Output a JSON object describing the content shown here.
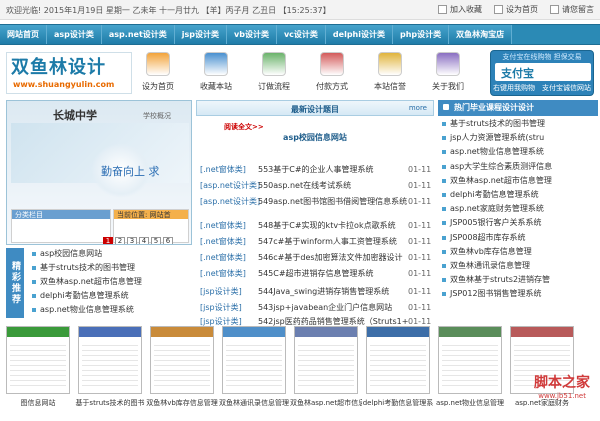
{
  "topbar": {
    "welcome": "欢迎光临! 2015年1月19日 星期一 乙未年 十一月廿九 【羊】丙子月 乙丑日 【15:25:37】",
    "links": [
      "加入收藏",
      "设为首页",
      "请您留言"
    ]
  },
  "nav": [
    "网站首页",
    "asp设计类",
    "asp.net设计类",
    "jsp设计类",
    "vb设计类",
    "vc设计类",
    "delphi设计类",
    "php设计类",
    "双鱼林淘宝店"
  ],
  "logo": {
    "text": "双鱼林设计",
    "url": "www.shuangyulin.com"
  },
  "quick": [
    {
      "label": "设为首页",
      "icon": "house-icon",
      "color": "#f2a33a"
    },
    {
      "label": "收藏本站",
      "icon": "bookmark-icon",
      "color": "#4a90d0"
    },
    {
      "label": "订做流程",
      "icon": "clipboard-icon",
      "color": "#6bb36b"
    },
    {
      "label": "付款方式",
      "icon": "payment-icon",
      "color": "#d35b5b"
    },
    {
      "label": "本站信誉",
      "icon": "medal-icon",
      "color": "#e0b43c"
    },
    {
      "label": "关于我们",
      "icon": "people-icon",
      "color": "#8a6fc2"
    }
  ],
  "alipay": {
    "top": "支付宝在线购物 担保交易",
    "logo": "支付宝",
    "left": "右键用我购物",
    "right": "支付宝诚信网站"
  },
  "banner": {
    "title": "长城中学",
    "sub": "学校概况",
    "motto": "勤奋向上  求",
    "box1": "分类栏目",
    "box2": "当前位置:  网站首"
  },
  "pager": [
    "1",
    "2",
    "3",
    "4",
    "5",
    "6"
  ],
  "recommend": {
    "tag": "精彩推荐",
    "items": [
      "asp校园信息网站",
      "基于struts技术的图书管理",
      "双鱼林asp.net超市信息管理",
      "delphi考勤信息管理系统",
      "asp.net物业信息管理系统"
    ]
  },
  "latest": {
    "title": "最新设计题目",
    "more": "more",
    "detail": "阅读全文>>",
    "featured": "asp校园信息网站",
    "rows": [
      {
        "cat": "[.net窗体类]",
        "title": "553基于C#的企业人事管理系统",
        "date": "01-11"
      },
      {
        "cat": "[asp.net设计类]",
        "title": "550asp.net在线考试系统",
        "date": "01-11"
      },
      {
        "cat": "[asp.net设计类]",
        "title": "549asp.net图书馆图书借阅管理信息系统",
        "date": "01-11"
      },
      {
        "cat": "[.net窗体类]",
        "title": "548基于C#实现的ktv卡拉ok点歌系统",
        "date": "01-11"
      },
      {
        "cat": "[.net窗体类]",
        "title": "547c#基于winform人事工资管理系统",
        "date": "01-11"
      },
      {
        "cat": "[.net窗体类]",
        "title": "546c#基于des加密算法文件加密器设计",
        "date": "01-11"
      },
      {
        "cat": "[.net窗体类]",
        "title": "545C#超市进销存信息管理系统",
        "date": "01-11"
      },
      {
        "cat": "[jsp设计类]",
        "title": "544Java_swing进销存销售管理系统",
        "date": "01-11"
      },
      {
        "cat": "[jsp设计类]",
        "title": "543jsp+javabean企业门户信息网站",
        "date": "01-11"
      },
      {
        "cat": "[jsp设计类]",
        "title": "542jsp医药药品销售管理系统（Struts1+",
        "date": "01-11"
      }
    ]
  },
  "hot": {
    "title": "热门毕业课程设计设计",
    "items": [
      "基于struts技术的图书管理",
      "jsp人力资源管理系统(stru",
      "asp.net物业信息管理系统",
      "asp大学生综合素质测评信息",
      "双鱼林asp.net超市信息管理",
      "delphi考勤信息管理系统",
      "asp.net家庭财务管理系统",
      "JSP005银行客户关系系统",
      "JSP008超市库存系统",
      "双鱼林vb库存信息管理",
      "双鱼林通讯录信息管理",
      "双鱼林基于struts2进销存管",
      "JSP012图书销售管理系统"
    ]
  },
  "thumbs": [
    {
      "cap": "图信息网站",
      "color": "#3a9a3a"
    },
    {
      "cap": "基于struts技术的图书",
      "color": "#4a6fb8"
    },
    {
      "cap": "双鱼林vb库存信息管理",
      "color": "#c98b3a"
    },
    {
      "cap": "双鱼林通讯录信息管理",
      "color": "#4f8fc9"
    },
    {
      "cap": "双鱼林asp.net超市信息",
      "color": "#6b7fb0"
    },
    {
      "cap": "delphi考勤信息管理系",
      "color": "#3d6ea8"
    },
    {
      "cap": "asp.net物业信息管理",
      "color": "#5a8d5a"
    },
    {
      "cap": "asp.net家庭财务",
      "color": "#b85a5a"
    }
  ],
  "watermark": {
    "main": "脚本之家",
    "sub": "www.jb51.net"
  }
}
